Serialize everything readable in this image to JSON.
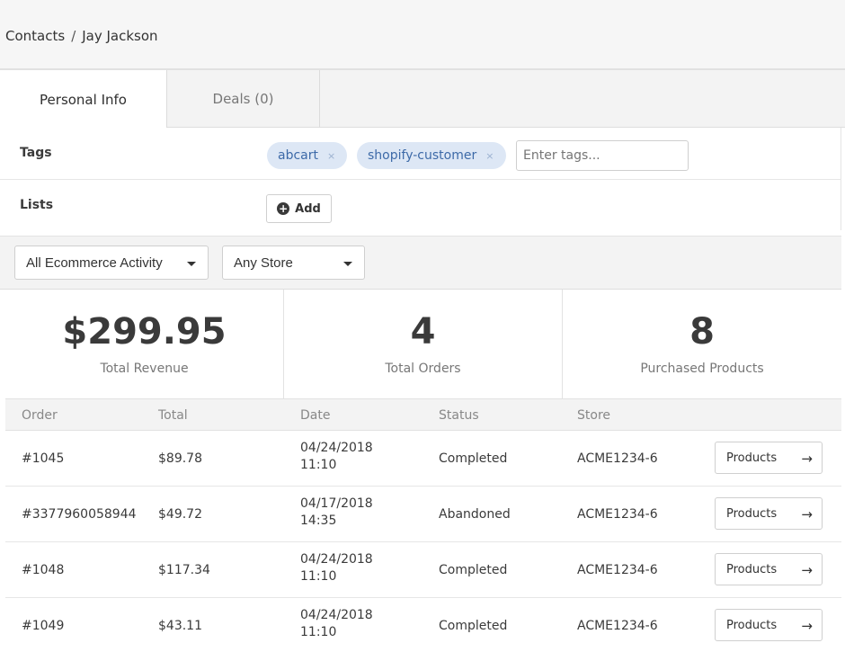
{
  "breadcrumb": {
    "root": "Contacts",
    "separator": "/",
    "current": "Jay Jackson"
  },
  "tabs": [
    {
      "label": "Personal Info"
    },
    {
      "label": "Deals (0)"
    }
  ],
  "fields": {
    "tags_label": "Tags",
    "tags": [
      {
        "label": "abcart",
        "remove": "×"
      },
      {
        "label": "shopify-customer",
        "remove": "×"
      }
    ],
    "tags_placeholder": "Enter tags...",
    "lists_label": "Lists",
    "add_label": "Add",
    "add_icon": "plus-circle-icon"
  },
  "filters": {
    "activity": "All Ecommerce Activity",
    "store": "Any Store"
  },
  "stats": [
    {
      "value": "$299.95",
      "label": "Total Revenue"
    },
    {
      "value": "4",
      "label": "Total Orders"
    },
    {
      "value": "8",
      "label": "Purchased Products"
    }
  ],
  "table": {
    "headers": {
      "order": "Order",
      "total": "Total",
      "date": "Date",
      "status": "Status",
      "store": "Store"
    },
    "rows": [
      {
        "order": "#1045",
        "total": "$89.78",
        "date": "04/24/2018",
        "time": "11:10",
        "status": "Completed",
        "store": "ACME1234-6",
        "action": "Products",
        "arrow": "→"
      },
      {
        "order": "#3377960058944",
        "total": "$49.72",
        "date": "04/17/2018",
        "time": "14:35",
        "status": "Abandoned",
        "store": "ACME1234-6",
        "action": "Products",
        "arrow": "→"
      },
      {
        "order": "#1048",
        "total": "$117.34",
        "date": "04/24/2018",
        "time": "11:10",
        "status": "Completed",
        "store": "ACME1234-6",
        "action": "Products",
        "arrow": "→"
      },
      {
        "order": "#1049",
        "total": "$43.11",
        "date": "04/24/2018",
        "time": "11:10",
        "status": "Completed",
        "store": "ACME1234-6",
        "action": "Products",
        "arrow": "→"
      }
    ]
  },
  "colors": {
    "tag_bg": "#dde7f5",
    "tag_text": "#3d6aa8",
    "header_bg": "#f6f6f6"
  }
}
